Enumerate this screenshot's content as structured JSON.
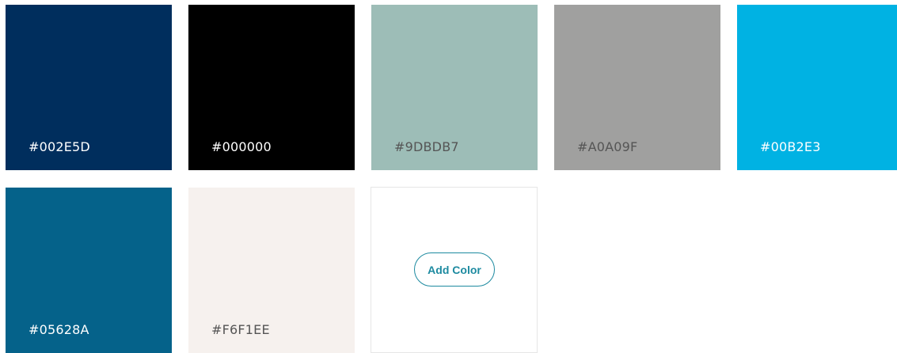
{
  "swatches": [
    {
      "label": "#002E5D",
      "color": "#002E5D",
      "text_color": "#ffffff"
    },
    {
      "label": "#000000",
      "color": "#000000",
      "text_color": "#ffffff"
    },
    {
      "label": "#9DBDB7",
      "color": "#9DBDB7",
      "text_color": "#555555"
    },
    {
      "label": "#A0A09F",
      "color": "#A0A09F",
      "text_color": "#555555"
    },
    {
      "label": "#00B2E3",
      "color": "#00B2E3",
      "text_color": "#ffffff"
    },
    {
      "label": "#05628A",
      "color": "#05628A",
      "text_color": "#ffffff"
    },
    {
      "label": "#F6F1EE",
      "color": "#F6F1EE",
      "text_color": "#555555"
    }
  ],
  "add_button": {
    "label": "Add Color",
    "accent_color": "#1D8AA0"
  }
}
